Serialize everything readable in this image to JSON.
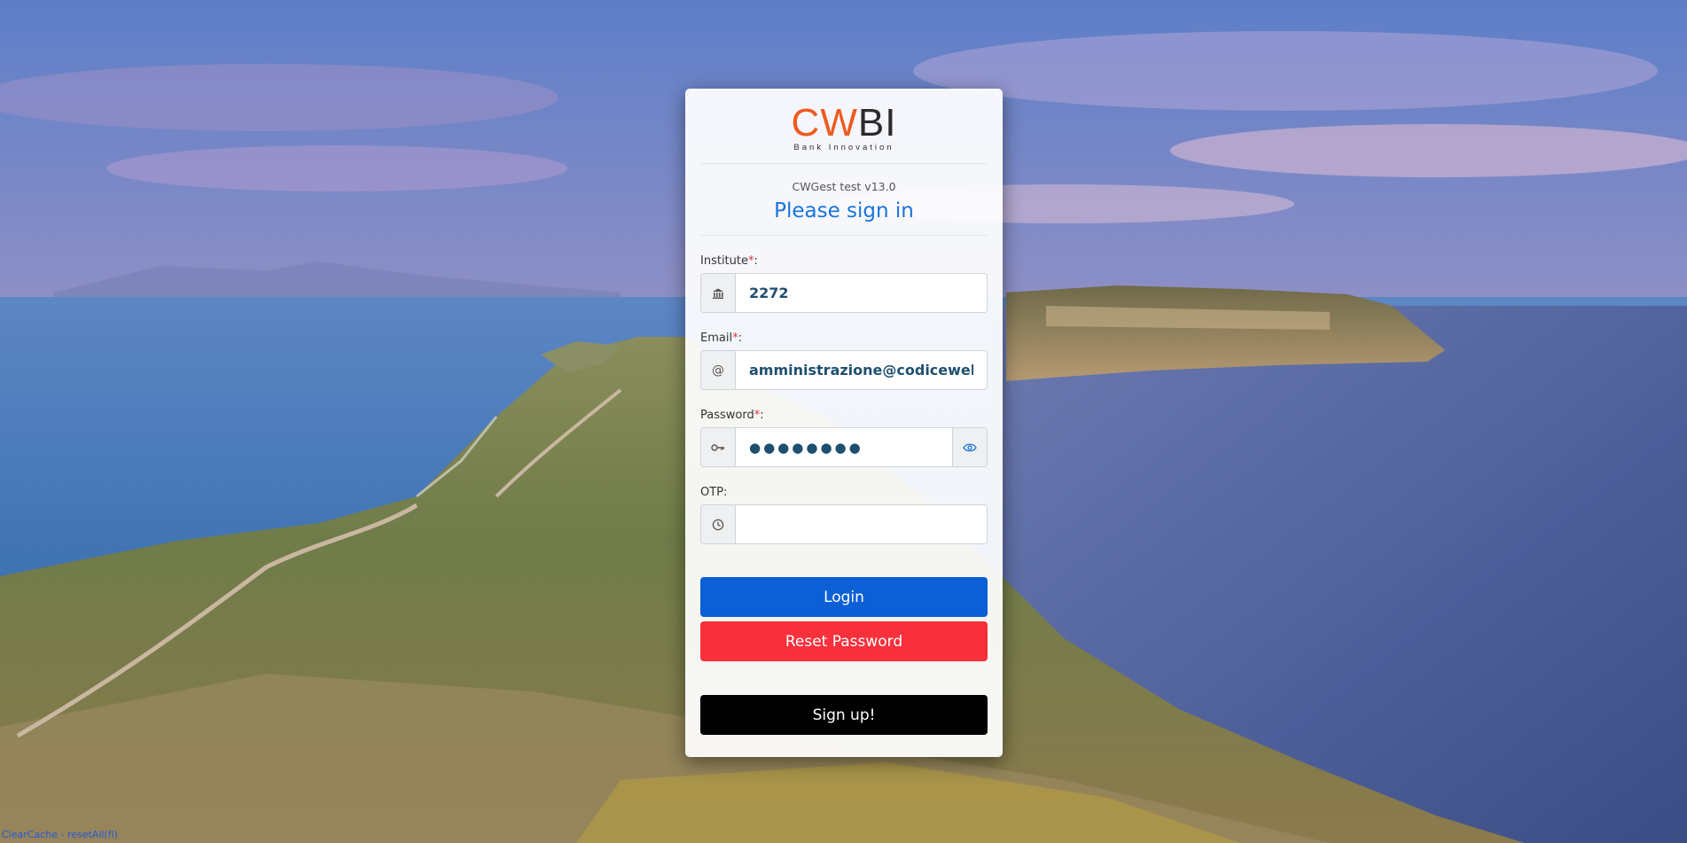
{
  "logo": {
    "part1": "CW",
    "part2": "BI",
    "tagline": "Bank Innovation",
    "colors": {
      "cw": "#ee5a1f",
      "bi": "#2b2b2b"
    }
  },
  "version": "CWGest test v13.0",
  "heading": "Please sign in",
  "fields": {
    "institute": {
      "label": "Institute",
      "required_mark": "*",
      "colon": ":",
      "value": "2272",
      "icon": "bank-icon"
    },
    "email": {
      "label": "Email",
      "required_mark": "*",
      "colon": ":",
      "value": "amministrazione@codiceweb.it",
      "icon": "at-icon"
    },
    "password": {
      "label": "Password",
      "required_mark": "*",
      "colon": ":",
      "value": "●●●●●●●●",
      "icon": "key-icon",
      "toggle_icon": "eye-icon"
    },
    "otp": {
      "label": "OTP:",
      "value": "",
      "icon": "clock-icon"
    }
  },
  "buttons": {
    "login": "Login",
    "reset": "Reset Password",
    "signup": "Sign up!"
  },
  "colors": {
    "accent": "#1a73d9",
    "login": "#0d5fd6",
    "reset": "#f8303b",
    "signup": "#000000",
    "required": "#dc3545"
  },
  "footer": {
    "link_text": "ClearCache - resetAll(fl)"
  }
}
